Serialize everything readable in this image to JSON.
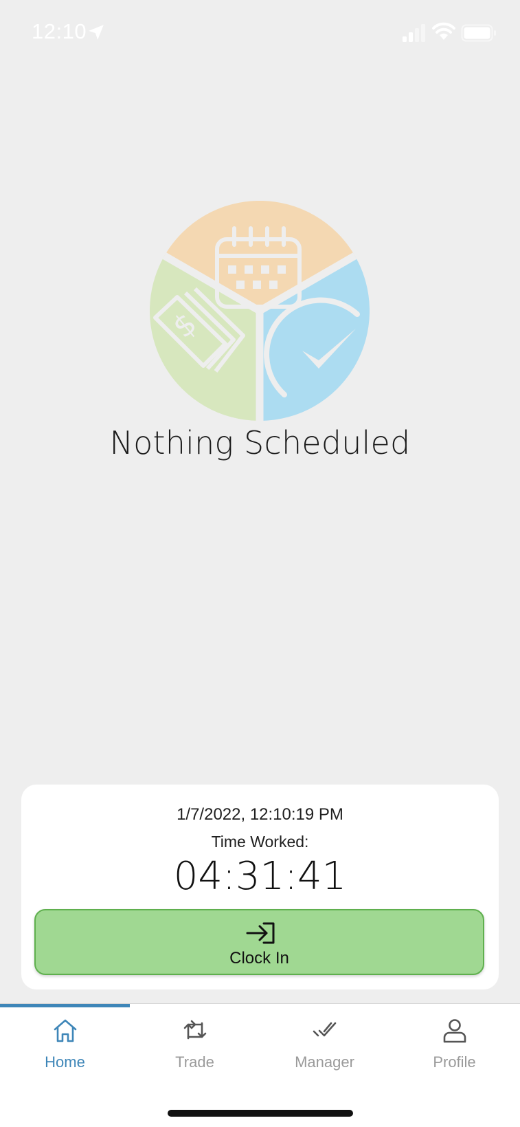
{
  "status_bar": {
    "time": "12:10",
    "icons": [
      "location-arrow-icon",
      "cellular-signal-icon",
      "wifi-icon",
      "battery-icon"
    ]
  },
  "empty_state": {
    "title": "Nothing Scheduled",
    "logo_icon": "schedule-pay-time-logo",
    "colors": {
      "orange": "#f4d8b2",
      "green": "#d7e7be",
      "blue": "#acdcf1"
    }
  },
  "clock_card": {
    "datetime": "1/7/2022, 12:10:19 PM",
    "label": "Time Worked:",
    "elapsed": "04:31:41",
    "button_label": "Clock In",
    "button_icon": "sign-in-icon",
    "button_color": "#a0d892"
  },
  "tab_bar": {
    "accent_color": "#3e86b8",
    "tabs": [
      {
        "label": "Home",
        "icon": "home-icon",
        "active": true
      },
      {
        "label": "Trade",
        "icon": "swap-icon",
        "active": false
      },
      {
        "label": "Manager",
        "icon": "checkmark-icon",
        "active": false
      },
      {
        "label": "Profile",
        "icon": "person-icon",
        "active": false
      }
    ]
  }
}
